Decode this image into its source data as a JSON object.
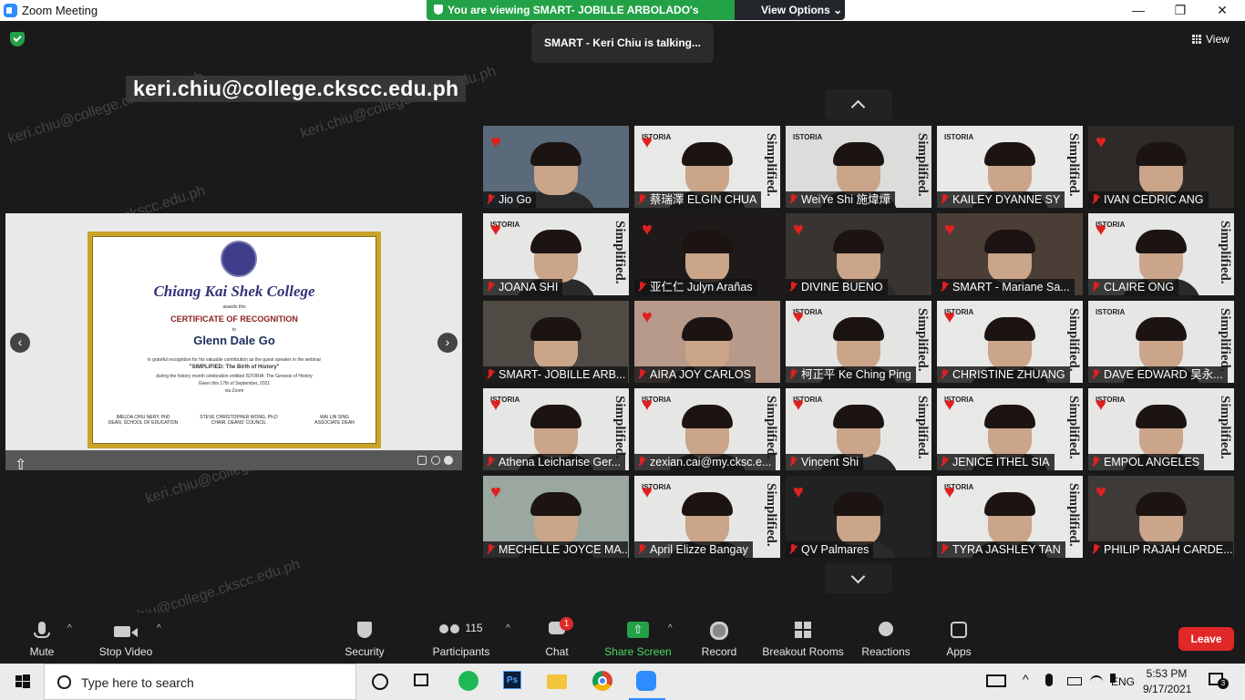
{
  "window": {
    "title": "Zoom Meeting",
    "minimize": "—",
    "maximize": "❐",
    "close": "✕"
  },
  "banner": {
    "message": "You are viewing SMART- JOBILLE ARBOLADO's screen",
    "view_options": "View Options ⌄"
  },
  "talking": "SMART - Keri Chiu is talking...",
  "view_label": "View",
  "email_label": "keri.chiu@college.ckscc.edu.ph",
  "watermark": "keri.chiu@college.ckscc.edu.ph",
  "shared_screen": {
    "certificate": {
      "college": "Chiang Kai Shek College",
      "awards_this": "awards this",
      "title": "CERTIFICATE OF RECOGNITION",
      "to": "to",
      "recipient": "Glenn Dale Go",
      "line1": "in grateful recognition for his valuable contribution as the guest speaker in the webinar",
      "webinar": "\"SIMPLIFIED: The Birth of History\"",
      "line2": "during the history month celebration entitled ISTORIA: The Genesis of History",
      "line3": "Given this 17th of September, 2021",
      "line4": "via Zoom",
      "sig1_name": "IMELDA CHIU NERY, PhD",
      "sig1_role": "DEAN, SCHOOL OF EDUCATION",
      "sig2_name": "STEVE CHRISTOPHER WONG, Ph.D",
      "sig2_role": "CHAIR, DEANS' COUNCIL",
      "sig3_name": "WAI LIN SING",
      "sig3_role": "ASSOCIATE DEAN"
    }
  },
  "participants_grid": [
    {
      "name": "Jio Go",
      "bg": "#5a6a7a",
      "heart": true,
      "poster": false
    },
    {
      "name": "蔡瑞澤 ELGIN CHUA",
      "bg": "#e8e8e6",
      "heart": true,
      "poster": true
    },
    {
      "name": "WeiYe Shi 施煒燁",
      "bg": "#dcdcda",
      "heart": false,
      "poster": true
    },
    {
      "name": "KAILEY DYANNE SY",
      "bg": "#e9e9e7",
      "heart": false,
      "poster": true
    },
    {
      "name": "IVAN CEDRIC ANG",
      "bg": "#2e2a28",
      "heart": true,
      "poster": false
    },
    {
      "name": "JOANA SHI",
      "bg": "#e6e6e4",
      "heart": true,
      "poster": true
    },
    {
      "name": "亚仁仁 Julyn Arañas",
      "bg": "#1e1a1a",
      "heart": true,
      "poster": false
    },
    {
      "name": "DIVINE BUENO",
      "bg": "#3a3430",
      "heart": true,
      "poster": false
    },
    {
      "name": "SMART - Mariane Sa...",
      "bg": "#4a3e36",
      "heart": true,
      "poster": false
    },
    {
      "name": "CLAIRE ONG",
      "bg": "#e6e6e4",
      "heart": true,
      "poster": true
    },
    {
      "name": "SMART- JOBILLE ARB...",
      "bg": "#504a44",
      "heart": false,
      "poster": false
    },
    {
      "name": "AIRA JOY CARLOS",
      "bg": "#b89a8a",
      "heart": true,
      "poster": false
    },
    {
      "name": "柯正平 Ke Ching Ping",
      "bg": "#e4e4e2",
      "heart": true,
      "poster": true
    },
    {
      "name": "CHRISTINE ZHUANG",
      "bg": "#e8e8e6",
      "heart": true,
      "poster": true
    },
    {
      "name": "DAVE EDWARD 吴永...",
      "bg": "#e6e6e4",
      "heart": false,
      "poster": true
    },
    {
      "name": "Athena Leicharise Ger...",
      "bg": "#e6e6e4",
      "heart": true,
      "poster": true
    },
    {
      "name": "zexian.cai@my.cksc.e...",
      "bg": "#e6e6e4",
      "heart": true,
      "poster": true
    },
    {
      "name": "Vincent Shi",
      "bg": "#e6e6e4",
      "heart": true,
      "poster": true
    },
    {
      "name": "JENICE ITHEL SIA",
      "bg": "#e8e8e6",
      "heart": true,
      "poster": true
    },
    {
      "name": "EMPOL ANGELES",
      "bg": "#e6e6e4",
      "heart": true,
      "poster": true
    },
    {
      "name": "MECHELLE JOYCE MA...",
      "bg": "#9aa8a0",
      "heart": true,
      "poster": false
    },
    {
      "name": "April Elizze Bangay",
      "bg": "#e6e6e4",
      "heart": true,
      "poster": true
    },
    {
      "name": "QV Palmares",
      "bg": "#222222",
      "heart": true,
      "poster": false
    },
    {
      "name": "TYRA JASHLEY TAN",
      "bg": "#e8e8e6",
      "heart": true,
      "poster": true
    },
    {
      "name": "PHILIP RAJAH CARDE...",
      "bg": "#3e3a38",
      "heart": true,
      "poster": false
    }
  ],
  "poster_text": {
    "istoria": "ISTORIA",
    "simplified": "Simplified."
  },
  "toolbar": {
    "mute": "Mute",
    "stop_video": "Stop Video",
    "security": "Security",
    "participants": "Participants",
    "participants_count": "115",
    "chat": "Chat",
    "chat_badge": "1",
    "share_screen": "Share Screen",
    "record": "Record",
    "breakout_rooms": "Breakout Rooms",
    "reactions": "Reactions",
    "apps": "Apps",
    "leave": "Leave"
  },
  "taskbar": {
    "search_placeholder": "Type here to search",
    "language": "ENG",
    "time": "5:53 PM",
    "date": "9/17/2021",
    "notification_count": "3"
  },
  "colors": {
    "accent_green": "#23a147",
    "zoom_blue": "#2d8cff",
    "leave_red": "#e02828",
    "heart_red": "#e02020"
  }
}
